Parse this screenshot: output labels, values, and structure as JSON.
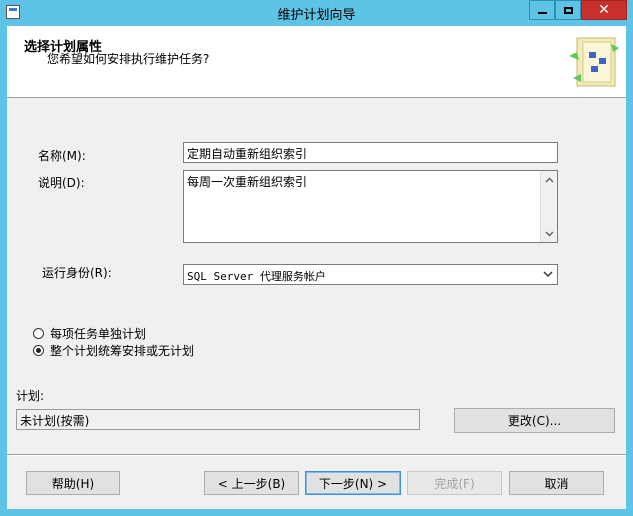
{
  "window": {
    "title": "维护计划向导"
  },
  "header": {
    "title": "选择计划属性",
    "subtitle": "您希望如何安排执行维护任务?"
  },
  "form": {
    "name_label": "名称(M):",
    "name_value": "定期自动重新组织索引",
    "desc_label": "说明(D):",
    "desc_value": "每周一次重新组织索引",
    "runas_label": "运行身份(R):",
    "runas_value": "SQL Server 代理服务帐户"
  },
  "options": {
    "separate_label": "每项任务单独计划",
    "single_label": "整个计划统筹安排或无计划",
    "selected": "single"
  },
  "schedule": {
    "label": "计划:",
    "value": "未计划(按需)",
    "change_button": "更改(C)..."
  },
  "footer": {
    "help": "帮助(H)",
    "back": "< 上一步(B)",
    "next": "下一步(N) >",
    "finish": "完成(F)",
    "cancel": "取消"
  },
  "icons": {
    "app": "window-app-icon",
    "wizard": "wizard-graphic"
  }
}
